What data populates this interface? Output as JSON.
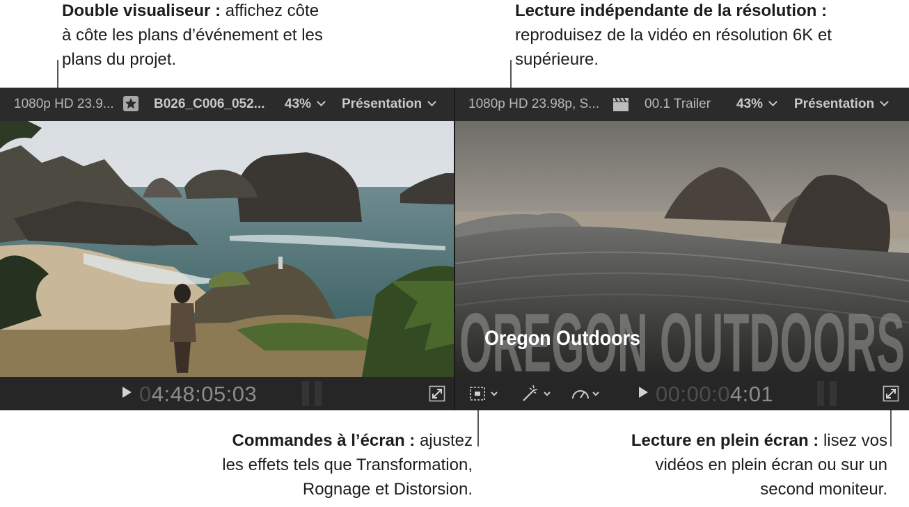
{
  "callouts": {
    "dual_viewer": {
      "title": "Double visualiseur :",
      "line1": " affichez côte",
      "line2": "à côte les plans d’événement et les",
      "line3": "plans du projet."
    },
    "resolution": {
      "title": "Lecture indépendante de la résolution :",
      "line2": "reproduisez de la vidéo en résolution 6K et",
      "line3": "supérieure."
    },
    "onscreen": {
      "title": "Commandes à l’écran :",
      "line1": " ajustez",
      "line2": "les effets tels que Transformation,",
      "line3": "Rognage et Distorsion."
    },
    "fullscreen": {
      "title": "Lecture en plein écran :",
      "line1": " lisez vos",
      "line2": "vidéos en plein écran ou sur un",
      "line3": "second moniteur."
    }
  },
  "viewer_left": {
    "format": "1080p HD 23.9...",
    "clip_icon": "star-icon",
    "clip_name": "B026_C006_052...",
    "zoom": "43%",
    "view_menu": "Présentation",
    "timecode_dim": "0",
    "timecode_lit": "4:48:05:03"
  },
  "viewer_right": {
    "format": "1080p HD 23.98p, S...",
    "clip_icon": "clapper-icon",
    "project_name": "00.1 Trailer",
    "zoom": "43%",
    "view_menu": "Présentation",
    "title_small": "Oregon Outdoors",
    "title_large": "OREGON OUTDOORS",
    "timecode_dim": "00:00:0",
    "timecode_lit": "4:01"
  },
  "colors": {
    "toolbar": "#2b2b2b",
    "timecode_lit": "#8c8c8c",
    "timecode_dim": "#4e4e4e"
  }
}
